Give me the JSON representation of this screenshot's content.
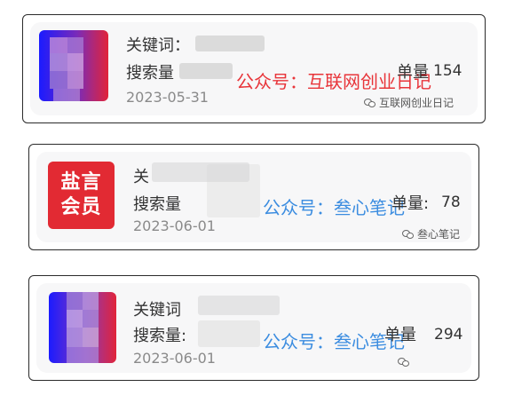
{
  "cards": [
    {
      "keyword_label": "关键词：",
      "keyword_value": "",
      "search_label": "搜索量",
      "single_label": "单量",
      "single_value": "154",
      "date": "2023-05-31",
      "watermark_big": "公众号：互联网创业日记",
      "watermark_small": "互联网创业日记"
    },
    {
      "thumb_line1": "盐言",
      "thumb_line2": "会员",
      "keyword_label": "关",
      "search_label": "搜索量",
      "single_label": "单量:",
      "single_value": "78",
      "date": "2023-06-01",
      "watermark_big": "公众号：叁心笔记",
      "watermark_small": "叁心笔记"
    },
    {
      "keyword_label": "关键词",
      "search_label": "搜索量:",
      "single_label": "单量",
      "single_value": "294",
      "date": "2023-06-01",
      "watermark_big": "公众号：叁心笔记",
      "watermark_small": ""
    }
  ],
  "colors": {
    "watermark_red": "#e8353a",
    "watermark_blue": "#3c8de0",
    "thumb_red": "#e22a33",
    "border": "#2b2b2b"
  }
}
